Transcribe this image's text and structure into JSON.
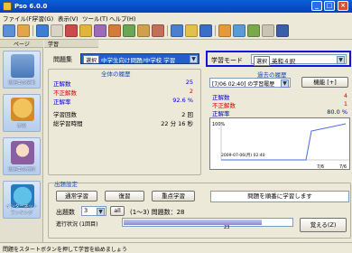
{
  "window": {
    "title": "Pso 6.0.0"
  },
  "menu": [
    "ファイル(F)",
    "学習(G)",
    "表示(V)",
    "ツール(T)",
    "ヘルプ(H)"
  ],
  "sidebar": {
    "header": "ページ",
    "items": [
      {
        "label": "問題集の情報",
        "icon": "book-stack-icon"
      },
      {
        "label": "学習",
        "icon": "cat-character-icon"
      },
      {
        "label": "問題集の管理",
        "icon": "person-icon"
      },
      {
        "label": "インターネット ランキング",
        "icon": "globe-icon"
      }
    ]
  },
  "content": {
    "tab": "学習",
    "collection_label": "問題集",
    "collection_select_btn": "選択",
    "collection_value": "中学生向け問題/中学校 学習",
    "mode_label": "学習モード",
    "mode_select_btn": "選択",
    "mode_value": "英和４択",
    "overall_title": "全体の履歴",
    "overall_stats": [
      {
        "label": "正解数",
        "value": "25",
        "tone": "blue"
      },
      {
        "label": "不正解数",
        "value": "2",
        "tone": "red"
      },
      {
        "label": "正解率",
        "value": "92.6 %",
        "tone": "blue"
      }
    ],
    "overall_stats2": [
      {
        "label": "学習回数",
        "value": "2 回"
      },
      {
        "label": "総学習時間",
        "value": "22 分 16 秒"
      }
    ],
    "history_title": "過去の履歴",
    "history_select": "[7/06 02:40] の学習履歴",
    "detail_button": "機能 [+]",
    "history_stats": [
      {
        "label": "正解数",
        "value": "4",
        "tone": "red"
      },
      {
        "label": "不正解数",
        "value": "1",
        "tone": "red"
      },
      {
        "label": "正解率",
        "value": "80.0 %",
        "tone": "blue"
      }
    ],
    "graph": {
      "y_top": "100%",
      "timestamp": "2009-07-06(月) 02:40",
      "x_labels": [
        "7/6",
        "7/6"
      ],
      "values": [
        0.8,
        1.0
      ]
    },
    "settings_title": "出題設定",
    "buttons": [
      "通常学習",
      "復習",
      "重点学習"
    ],
    "message": "問題を順番に学習します",
    "count_label": "出題数",
    "count_value": "3",
    "all_button": "all",
    "range_text": "(1〜3) 問題数：28",
    "progress_label": "進行状況 (1回目)",
    "progress_value": 0.82,
    "progress_number": "23",
    "start_button": "覚える(Z)"
  },
  "status": "問題をスタートボタンを押して学習を始めましょう",
  "colors": {
    "titlebar": "#0a5fd8",
    "selection": "#2060c8",
    "mode_outline": "#1212d8",
    "correct": "#0000c8",
    "incorrect": "#d40000"
  }
}
